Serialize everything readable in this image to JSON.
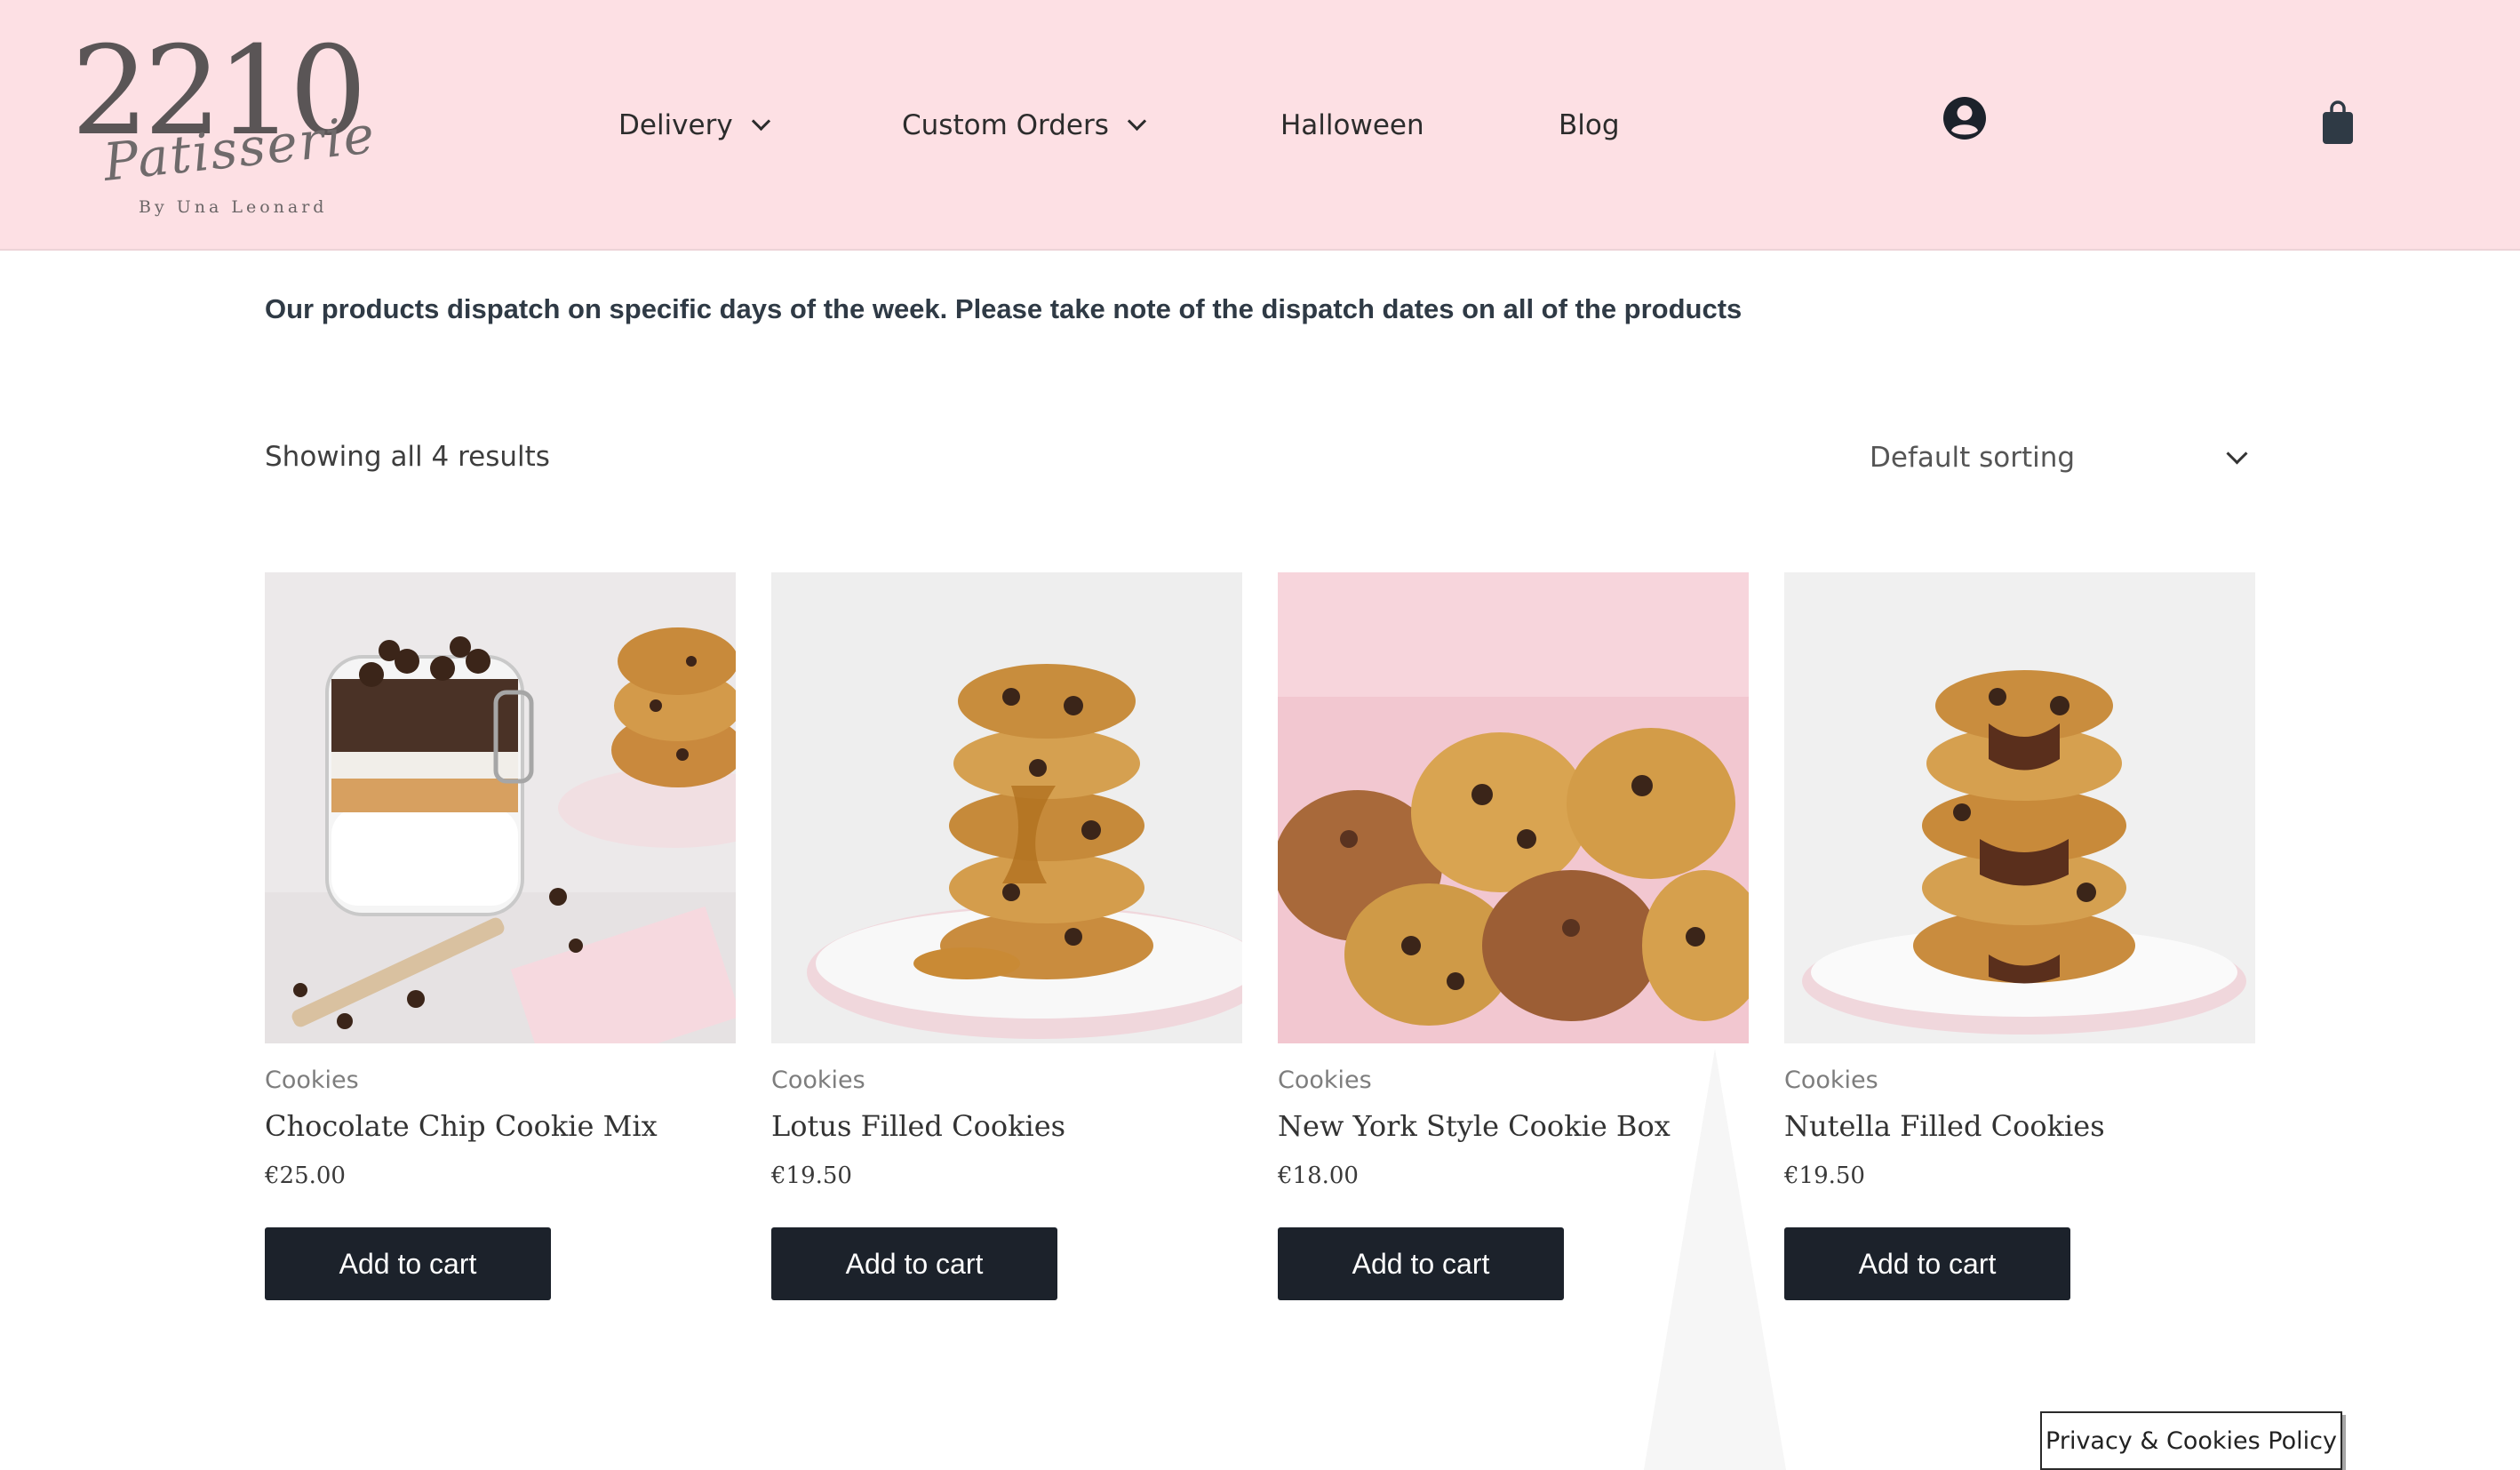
{
  "brand": {
    "number": "2210",
    "script": "Patisserie",
    "byline": "By Una Leonard"
  },
  "nav": {
    "items": [
      {
        "label": "Delivery",
        "dropdown": true
      },
      {
        "label": "Custom Orders",
        "dropdown": true
      },
      {
        "label": "Halloween",
        "dropdown": false
      },
      {
        "label": "Blog",
        "dropdown": false
      }
    ],
    "icons": [
      "user-account-icon",
      "shopping-bag-icon"
    ]
  },
  "notice": "Our products dispatch on specific days of the week. Please take note of the dispatch dates on all of the products",
  "toolbar": {
    "result_count": "Showing all 4 results",
    "sort_selected": "Default sorting"
  },
  "products": [
    {
      "category": "Cookies",
      "title": "Chocolate Chip Cookie Mix",
      "price": "€25.00",
      "button": "Add to cart",
      "image": "cookie-jar-mix-image"
    },
    {
      "category": "Cookies",
      "title": "Lotus Filled Cookies",
      "price": "€19.50",
      "button": "Add to cart",
      "image": "lotus-cookie-stack-image"
    },
    {
      "category": "Cookies",
      "title": "New York Style Cookie Box",
      "price": "€18.00",
      "button": "Add to cart",
      "image": "cookie-box-image"
    },
    {
      "category": "Cookies",
      "title": "Nutella Filled Cookies",
      "price": "€19.50",
      "button": "Add to cart",
      "image": "nutella-cookie-stack-image"
    }
  ],
  "cookie_policy": "Privacy & Cookies Policy",
  "colors": {
    "header_bg": "#fde0e4",
    "button_bg": "#1c222b",
    "text_dark": "#2f3a45"
  }
}
